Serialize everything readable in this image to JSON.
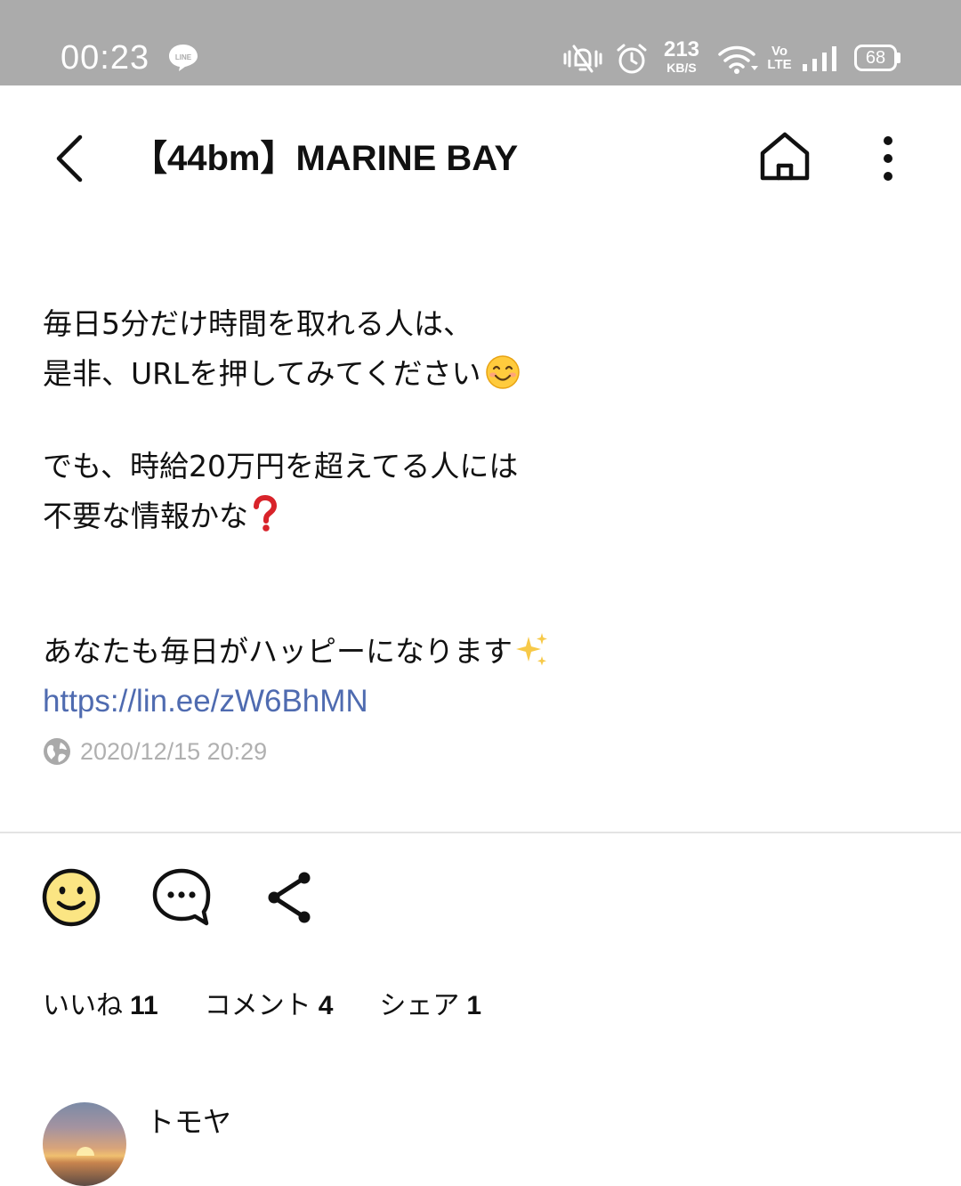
{
  "status_bar": {
    "time": "00:23",
    "speed_value": "213",
    "speed_unit": "KB/S",
    "volte_top": "Vo",
    "volte_bottom": "LTE",
    "battery": "68",
    "icons": [
      "line-app-icon",
      "vibrate-mute-icon",
      "alarm-icon",
      "wifi-icon",
      "signal-icon",
      "battery-icon"
    ],
    "background_color": "#ababab"
  },
  "header": {
    "title": "【44bm】MARINE BAY",
    "icons": [
      "back-icon",
      "home-icon",
      "more-icon"
    ]
  },
  "post": {
    "lines": [
      "毎日5分だけ時間を取れる人は、",
      "是非、URLを押してみてください",
      "でも、時給20万円を超えてる人には",
      "不要な情報かな",
      "あなたも毎日がハッピーになります"
    ],
    "emojis": [
      "smiling-face-emoji",
      "question-mark-emoji",
      "sparkles-emoji"
    ],
    "link": "https://lin.ee/zW6BhMN",
    "link_color": "#4f6bb0",
    "timestamp": "2020/12/15 20:29"
  },
  "actions": {
    "icons": [
      "like-icon",
      "comment-icon",
      "share-icon"
    ],
    "like_label": "いいね",
    "like_count": "11",
    "comment_label": "コメント",
    "comment_count": "4",
    "share_label": "シェア",
    "share_count": "1"
  },
  "comment_preview": {
    "author": "トモヤ"
  }
}
